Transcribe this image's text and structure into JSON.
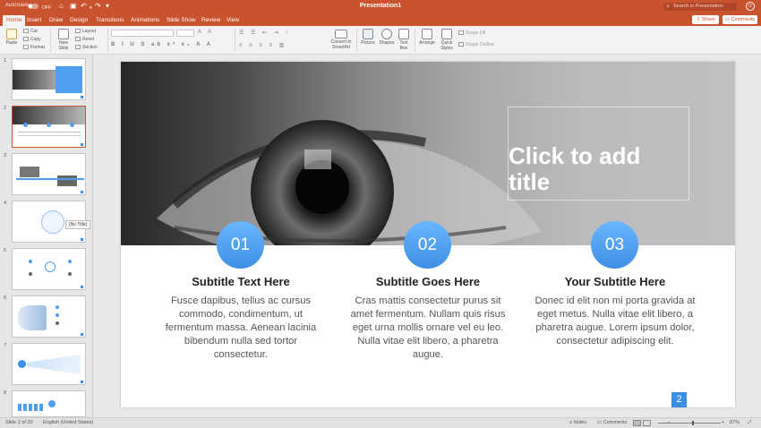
{
  "titlebar": {
    "autosave_label": "AutoSave",
    "autosave_state": "OFF",
    "document_title": "Presentation1",
    "search_placeholder": "Search in Presentation"
  },
  "tabs": [
    "Home",
    "Insert",
    "Draw",
    "Design",
    "Transitions",
    "Animations",
    "Slide Show",
    "Review",
    "View"
  ],
  "active_tab": "Home",
  "share_label": "Share",
  "comments_label": "Comments",
  "ribbon": {
    "paste": "Paste",
    "cut": "Cut",
    "copy": "Copy",
    "format": "Format",
    "new_slide": "New Slide",
    "layout": "Layout",
    "reset": "Reset",
    "section": "Section",
    "convert_to_smartart": "Convert to SmartArt",
    "picture": "Picture",
    "shapes": "Shapes",
    "text_box": "Text Box",
    "arrange": "Arrange",
    "quick_styles": "Quick Styles",
    "shape_fill": "Shape Fill",
    "shape_outline": "Shape Outline"
  },
  "sidebar": {
    "slide_numbers": [
      "1",
      "2",
      "3",
      "4",
      "5",
      "6",
      "7",
      "8"
    ],
    "selected_slide": "2",
    "tooltip": "(No Title)"
  },
  "slide": {
    "title_placeholder": "Click to add title",
    "page_number": "2",
    "columns": [
      {
        "number": "01",
        "title": "Subtitle Text Here",
        "body": "Fusce dapibus, tellus ac cursus commodo, condimentum, ut fermentum massa. Aenean lacinia bibendum nulla sed tortor consectetur."
      },
      {
        "number": "02",
        "title": "Subtitle Goes Here",
        "body": "Cras mattis consectetur purus sit amet fermentum. Nullam quis risus eget urna mollis ornare vel eu leo. Nulla vitae elit libero, a pharetra augue."
      },
      {
        "number": "03",
        "title": "Your Subtitle Here",
        "body": "Donec id elit non mi porta gravida at eget metus. Nulla vitae elit libero, a pharetra augue. Lorem ipsum dolor, consectetur adipiscing elit."
      }
    ]
  },
  "statusbar": {
    "slide_info": "Slide 2 of 20",
    "language": "English (United States)",
    "notes": "Notes",
    "comments": "Comments",
    "zoom": "87%"
  },
  "colors": {
    "accent": "#c9522f",
    "blue": "#3d8fe6"
  }
}
